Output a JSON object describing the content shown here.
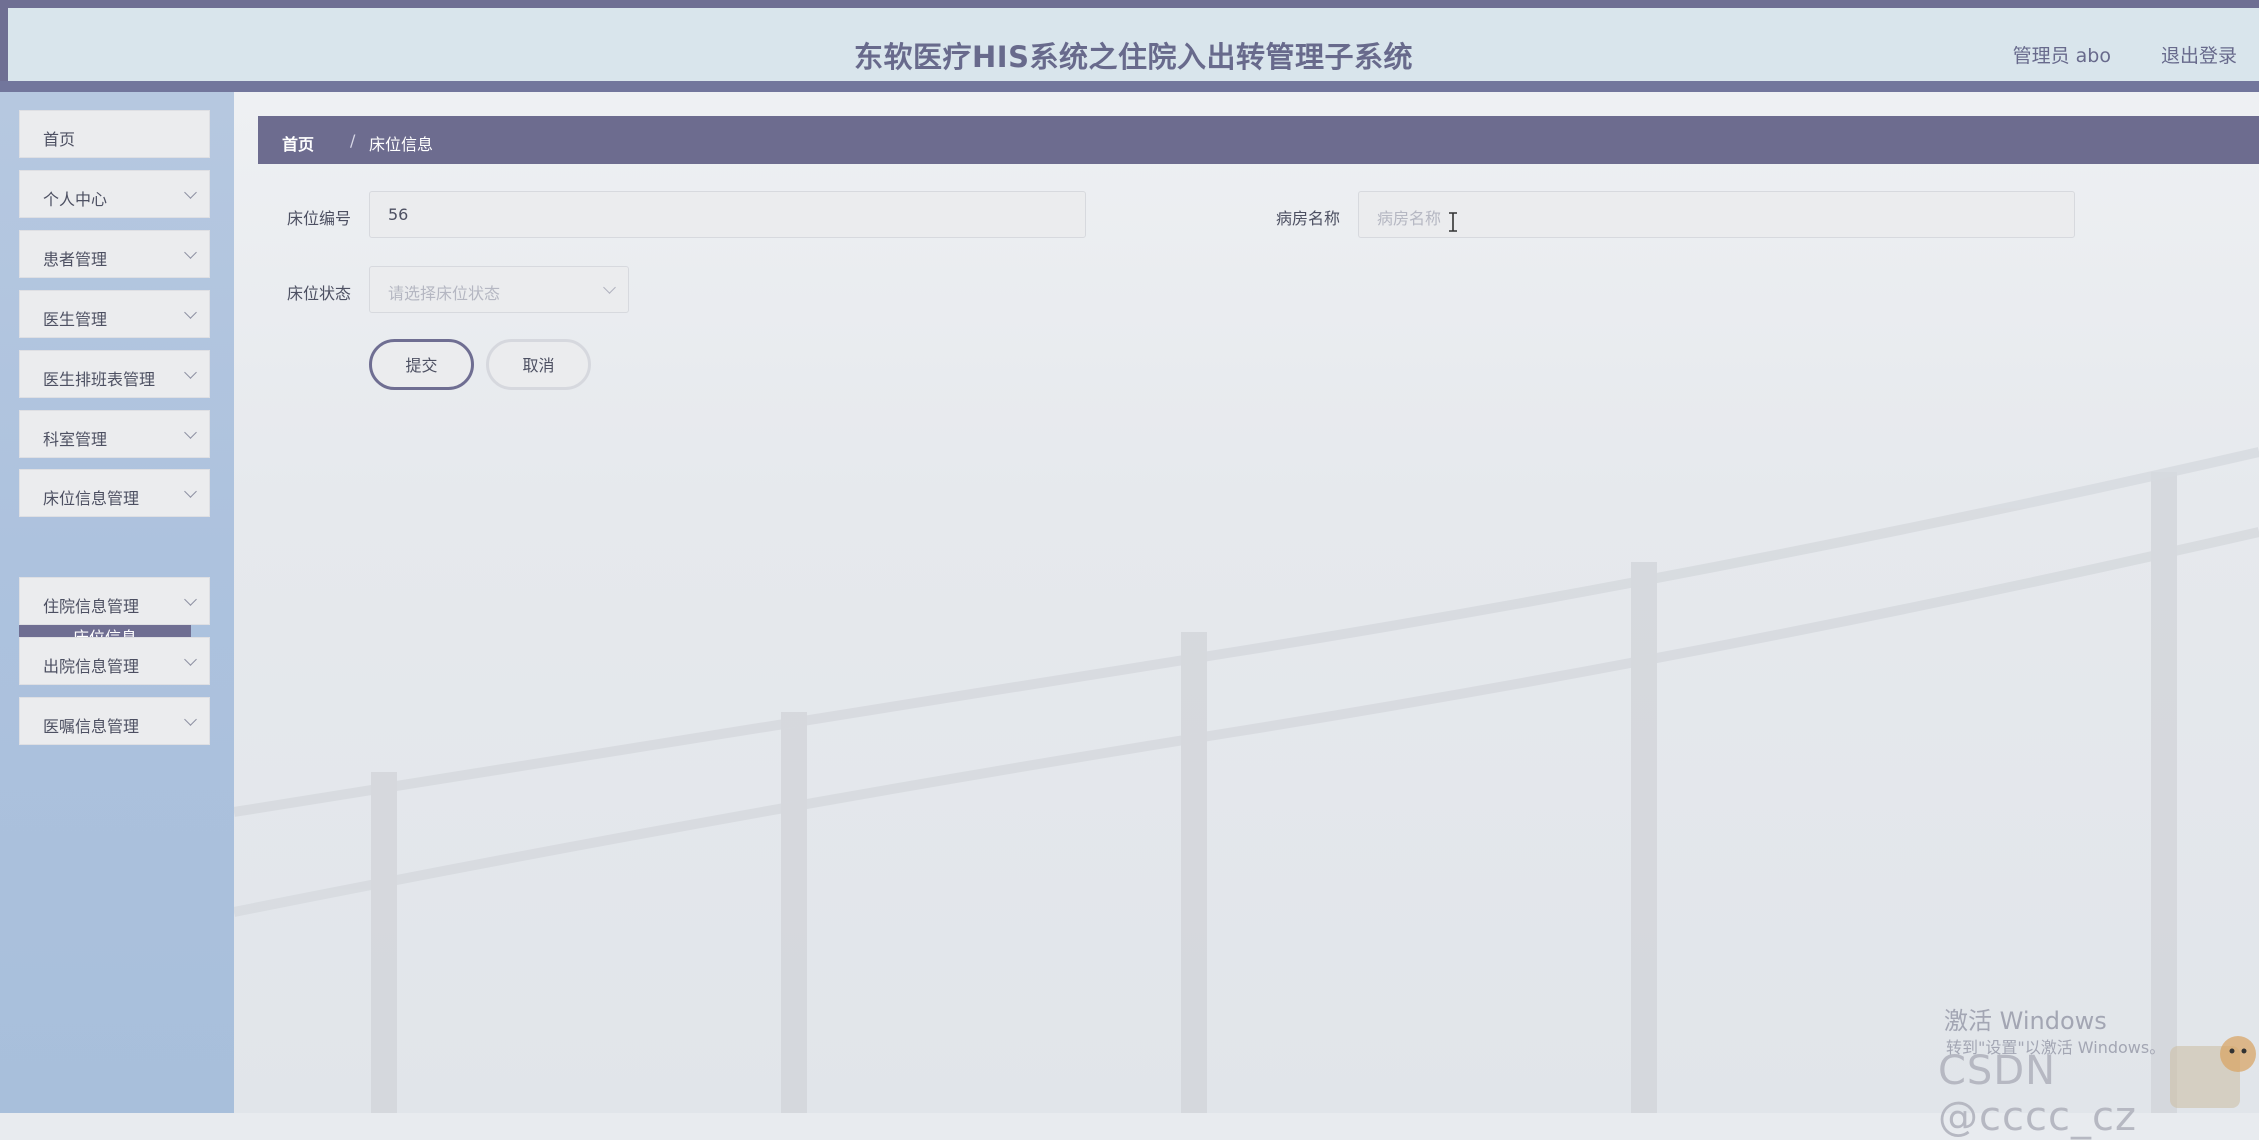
{
  "header": {
    "title": "东软医疗HIS系统之住院入出转管理子系统",
    "user": "管理员 abo",
    "logout": "退出登录"
  },
  "sidebar": {
    "items": [
      {
        "label": "首页",
        "has_arrow": false
      },
      {
        "label": "个人中心",
        "has_arrow": true
      },
      {
        "label": "患者管理",
        "has_arrow": true
      },
      {
        "label": "医生管理",
        "has_arrow": true
      },
      {
        "label": "医生排班表管理",
        "has_arrow": true
      },
      {
        "label": "科室管理",
        "has_arrow": true
      },
      {
        "label": "床位信息管理",
        "has_arrow": true
      },
      {
        "label": "住院信息管理",
        "has_arrow": true
      },
      {
        "label": "出院信息管理",
        "has_arrow": true
      },
      {
        "label": "医嘱信息管理",
        "has_arrow": true
      }
    ],
    "active_sub": "床位信息"
  },
  "breadcrumb": {
    "home": "首页",
    "separator": "/",
    "current": "床位信息"
  },
  "form": {
    "bed_no_label": "床位编号",
    "bed_no_value": "56",
    "ward_name_label": "病房名称",
    "ward_name_placeholder": "病房名称",
    "bed_status_label": "床位状态",
    "bed_status_placeholder": "请选择床位状态",
    "submit": "提交",
    "cancel": "取消"
  },
  "watermarks": {
    "activate": "激活 Windows",
    "goto": "转到\"设置\"以激活 Windows。",
    "csdn": "CSDN @cccc_cz"
  },
  "colors": {
    "accent": "#6f6e92",
    "header_bg": "#d9e5ec",
    "sidebar_bg": "#adc2de",
    "text": "#4d5062"
  }
}
